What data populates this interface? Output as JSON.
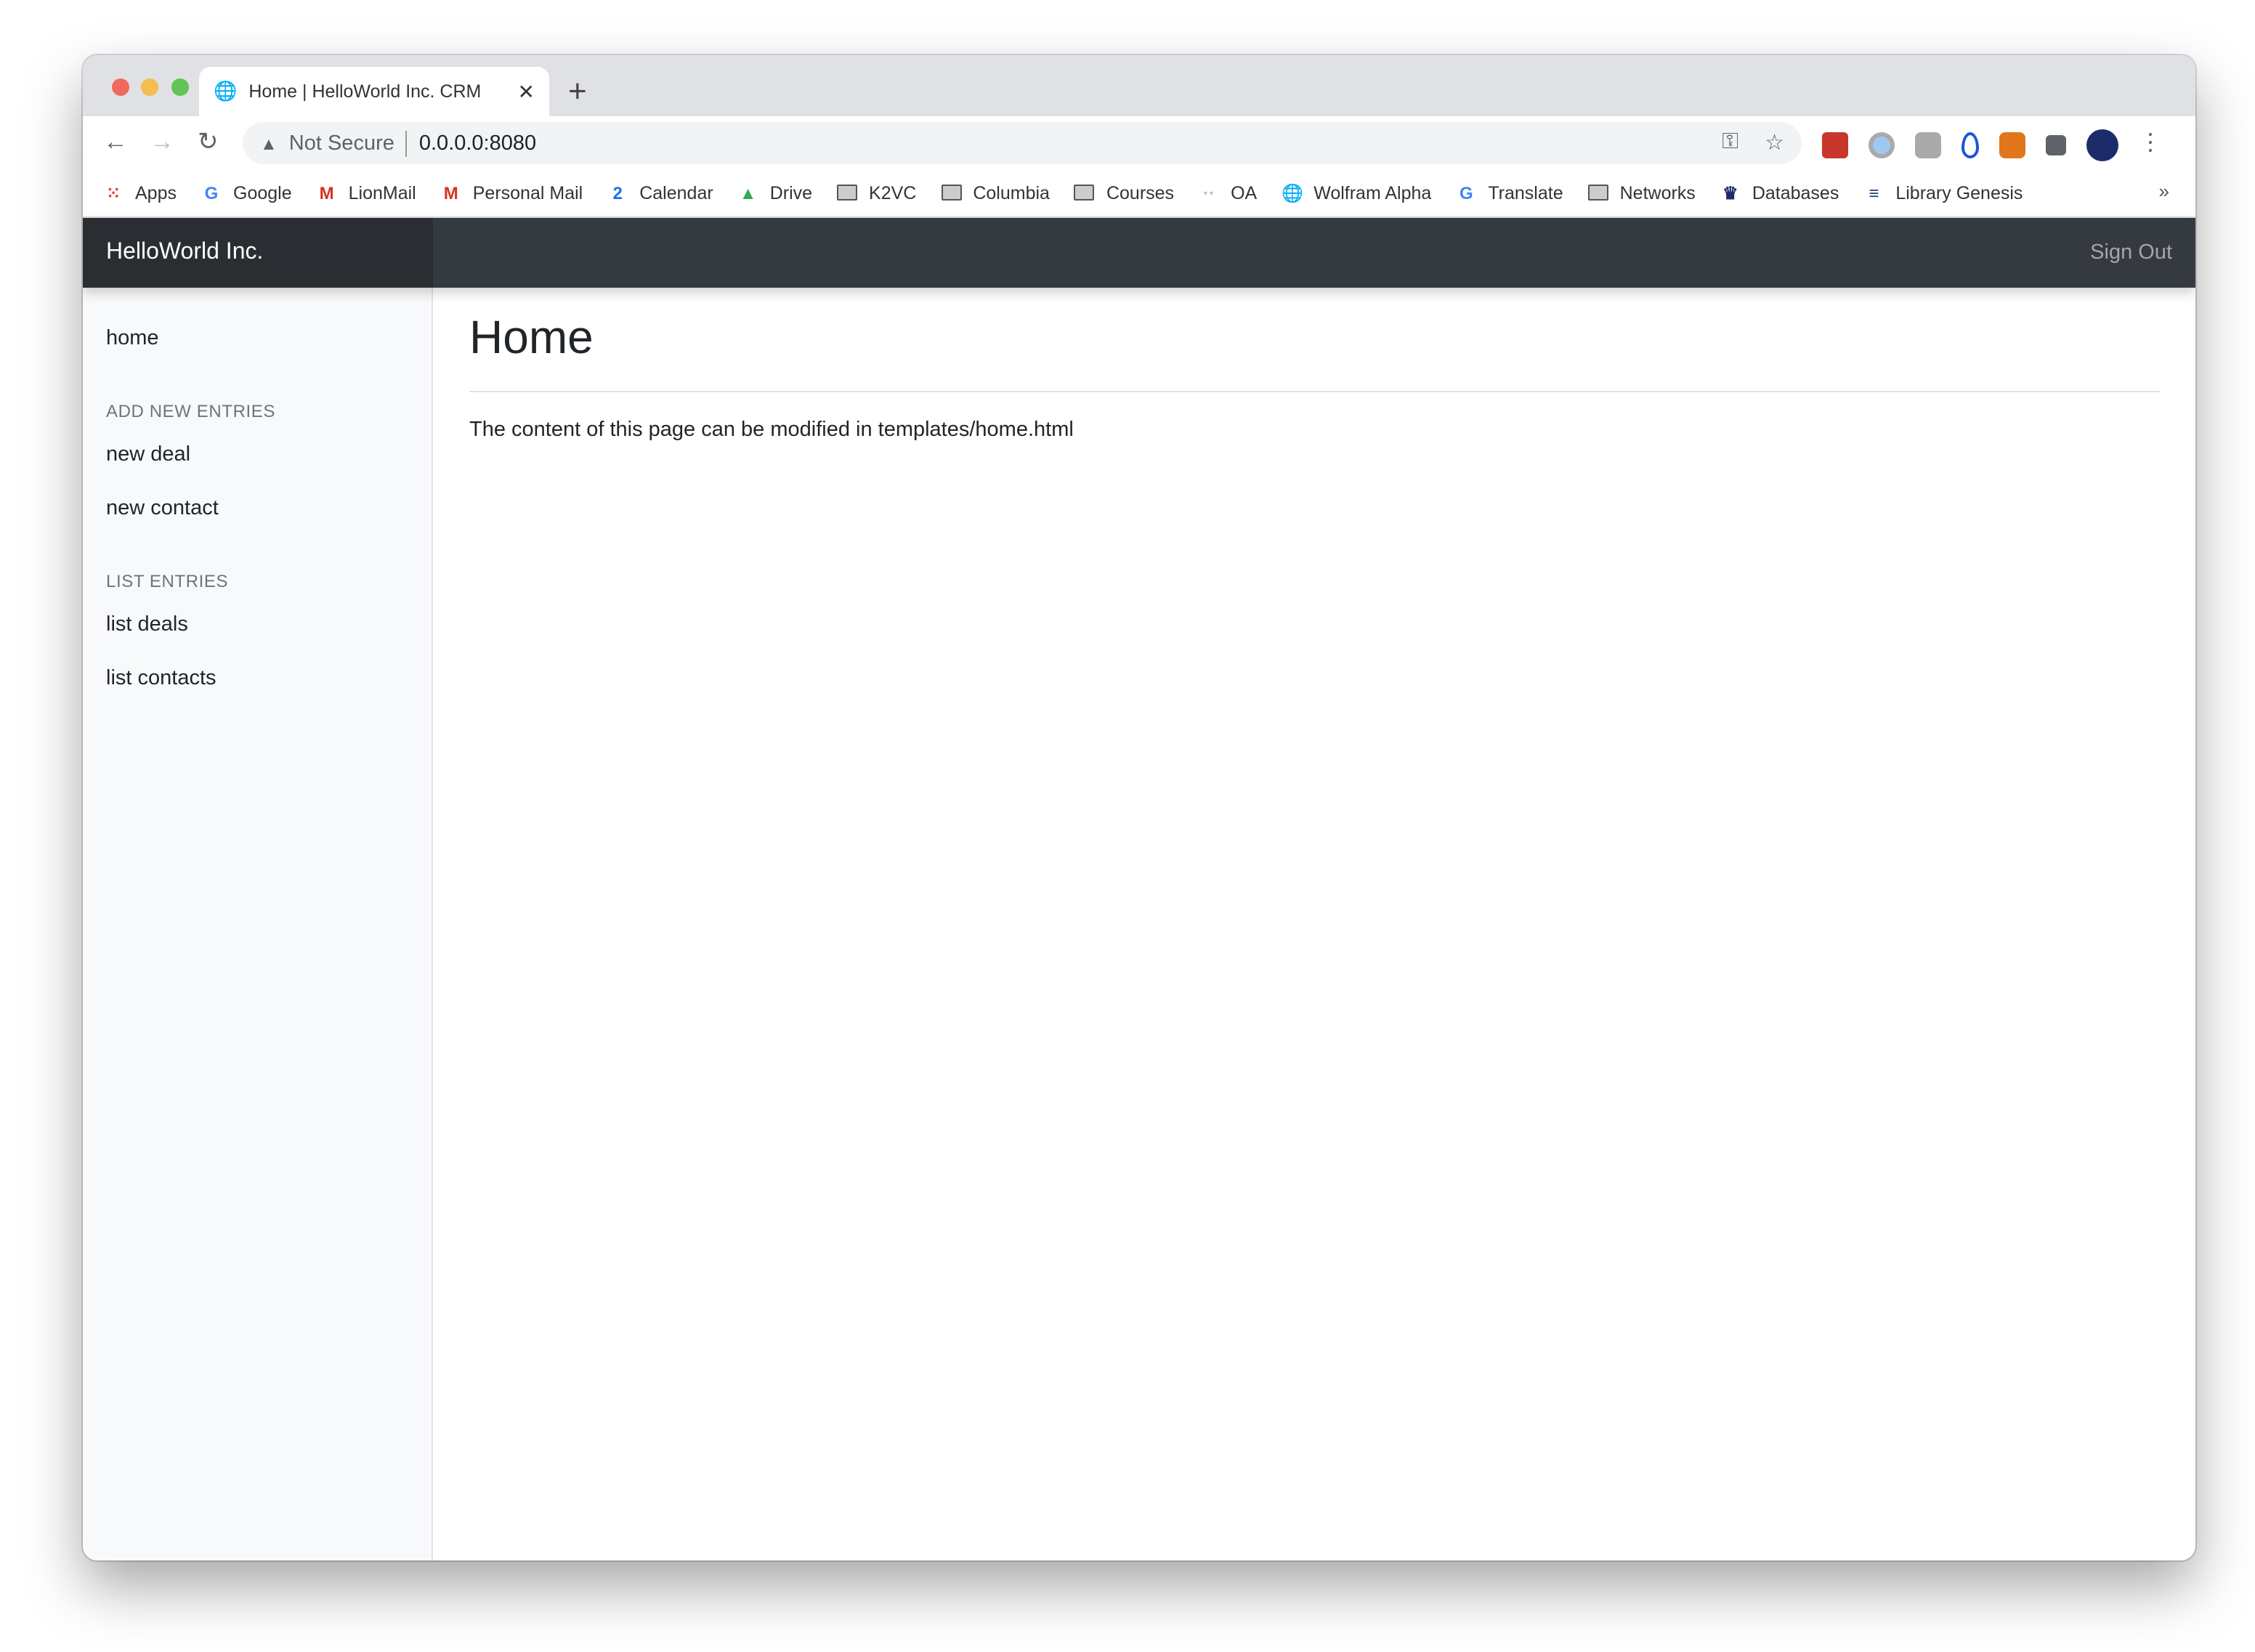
{
  "browser": {
    "tab_title": "Home | HelloWorld Inc. CRM",
    "security_label": "Not Secure",
    "url": "0.0.0.0:8080",
    "bookmarks": [
      {
        "label": "Apps",
        "icon": "apps-grid-icon"
      },
      {
        "label": "Google",
        "icon": "google-icon"
      },
      {
        "label": "LionMail",
        "icon": "gmail-icon"
      },
      {
        "label": "Personal Mail",
        "icon": "gmail-icon"
      },
      {
        "label": "Calendar",
        "icon": "calendar-icon"
      },
      {
        "label": "Drive",
        "icon": "drive-icon"
      },
      {
        "label": "K2VC",
        "icon": "folder-icon"
      },
      {
        "label": "Columbia",
        "icon": "folder-icon"
      },
      {
        "label": "Courses",
        "icon": "folder-icon"
      },
      {
        "label": "OA",
        "icon": "dots-icon"
      },
      {
        "label": "Wolfram Alpha",
        "icon": "globe-icon"
      },
      {
        "label": "Translate",
        "icon": "translate-icon"
      },
      {
        "label": "Networks",
        "icon": "folder-icon"
      },
      {
        "label": "Databases",
        "icon": "crown-icon"
      },
      {
        "label": "Library Genesis",
        "icon": "libgen-icon"
      }
    ],
    "more_bookmarks": "»"
  },
  "navbar": {
    "brand": "HelloWorld Inc.",
    "sign_out": "Sign Out",
    "bg": "#343a40"
  },
  "sidebar": {
    "home": "home",
    "add_header": "ADD NEW ENTRIES",
    "new_deal": "new deal",
    "new_contact": "new contact",
    "list_header": "LIST ENTRIES",
    "list_deals": "list deals",
    "list_contacts": "list contacts"
  },
  "main": {
    "title": "Home",
    "body": "The content of this page can be modified in templates/home.html"
  }
}
